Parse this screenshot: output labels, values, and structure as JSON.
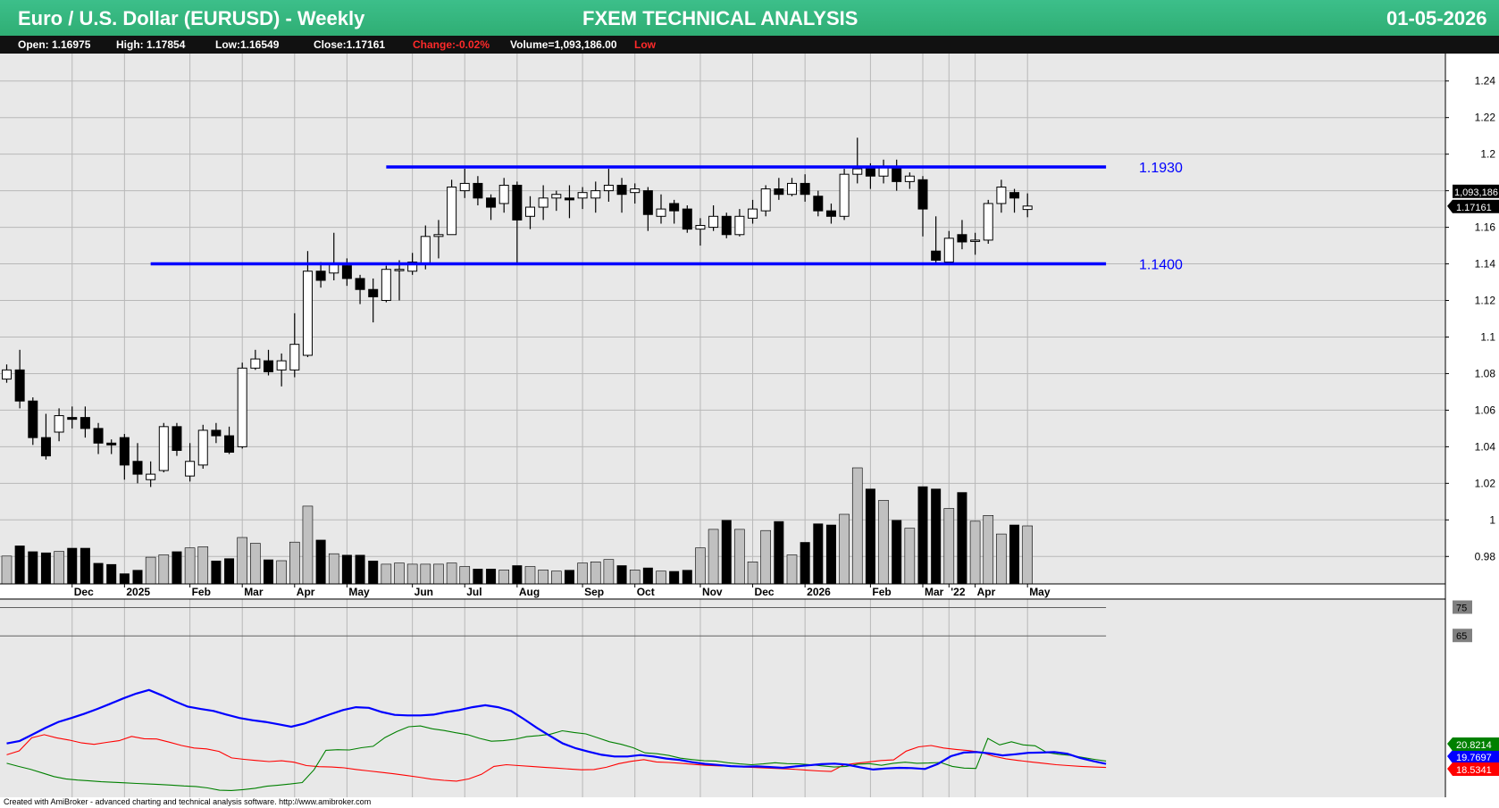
{
  "header": {
    "left_title": "Euro / U.S. Dollar (EURUSD) - Weekly",
    "center_title": "FXEM TECHNICAL ANALYSIS",
    "date": "01-05-2026"
  },
  "info": {
    "open": "Open: 1.16975",
    "high": "High: 1.17854",
    "low": "Low:1.16549",
    "close": "Close:1.17161",
    "change": "Change:-0.02%",
    "volume": "Volume=1,093,186.00",
    "low_flag": "Low"
  },
  "footer": "Created with AmiBroker - advanced charting and technical analysis software. http://www.amibroker.com",
  "colors": {
    "bull_fill": "#ffffff",
    "bear_fill": "#000000",
    "bear_volume": "#000000",
    "bull_volume": "#c0c0c0",
    "channel": "#0000ff",
    "adx": "#0000ff",
    "plus_di": "#008000",
    "minus_di": "#ff0000",
    "plot_bg": "#e8e8e8",
    "grid": "#b8b8b8"
  },
  "chart_data": [
    {
      "type": "candlestick",
      "title": "Euro / U.S. Dollar (EURUSD) - Weekly",
      "ylim": [
        0.965,
        1.255
      ],
      "y_ticks": [
        0.98,
        1,
        1.02,
        1.04,
        1.06,
        1.08,
        1.1,
        1.12,
        1.14,
        1.16,
        1.18,
        1.2,
        1.22,
        1.24
      ],
      "y_tick_labels": [
        "0.98",
        "1",
        "1.02",
        "1.04",
        "1.06",
        "1.08",
        "1.1",
        "1.12",
        "1.14",
        "1.16",
        "1.18",
        "1.2",
        "1.22",
        "1.24"
      ],
      "x_labels": [
        {
          "bar": 5,
          "label": "Dec"
        },
        {
          "bar": 9,
          "label": "2025"
        },
        {
          "bar": 14,
          "label": "Feb"
        },
        {
          "bar": 18,
          "label": "Mar"
        },
        {
          "bar": 22,
          "label": "Apr"
        },
        {
          "bar": 26,
          "label": "May"
        },
        {
          "bar": 31,
          "label": "Jun"
        },
        {
          "bar": 35,
          "label": "Jul"
        },
        {
          "bar": 39,
          "label": "Aug"
        },
        {
          "bar": 44,
          "label": "Sep"
        },
        {
          "bar": 48,
          "label": "Oct"
        },
        {
          "bar": 53,
          "label": "Nov"
        },
        {
          "bar": 57,
          "label": "Dec"
        },
        {
          "bar": 61,
          "label": "2026"
        },
        {
          "bar": 66,
          "label": "Feb"
        },
        {
          "bar": 70,
          "label": "Mar"
        },
        {
          "bar": 72,
          "label": "'22"
        },
        {
          "bar": 74,
          "label": "Apr"
        },
        {
          "bar": 78,
          "label": "May"
        }
      ],
      "candles": [
        [
          1.077,
          1.082,
          1.085,
          1.075
        ],
        [
          1.082,
          1.065,
          1.093,
          1.061
        ],
        [
          1.065,
          1.045,
          1.067,
          1.041
        ],
        [
          1.045,
          1.035,
          1.058,
          1.033
        ],
        [
          1.048,
          1.057,
          1.061,
          1.043
        ],
        [
          1.056,
          1.055,
          1.062,
          1.05
        ],
        [
          1.056,
          1.05,
          1.062,
          1.045
        ],
        [
          1.05,
          1.042,
          1.053,
          1.036
        ],
        [
          1.042,
          1.041,
          1.044,
          1.036
        ],
        [
          1.045,
          1.03,
          1.047,
          1.022
        ],
        [
          1.032,
          1.025,
          1.042,
          1.02
        ],
        [
          1.022,
          1.025,
          1.032,
          1.018
        ],
        [
          1.027,
          1.051,
          1.053,
          1.026
        ],
        [
          1.051,
          1.038,
          1.053,
          1.035
        ],
        [
          1.024,
          1.032,
          1.042,
          1.021
        ],
        [
          1.03,
          1.049,
          1.052,
          1.028
        ],
        [
          1.049,
          1.046,
          1.053,
          1.042
        ],
        [
          1.046,
          1.037,
          1.051,
          1.036
        ],
        [
          1.04,
          1.083,
          1.086,
          1.039
        ],
        [
          1.083,
          1.088,
          1.093,
          1.082
        ],
        [
          1.087,
          1.081,
          1.093,
          1.079
        ],
        [
          1.082,
          1.087,
          1.091,
          1.073
        ],
        [
          1.082,
          1.096,
          1.113,
          1.078
        ],
        [
          1.09,
          1.136,
          1.147,
          1.089
        ],
        [
          1.136,
          1.131,
          1.141,
          1.127
        ],
        [
          1.135,
          1.14,
          1.157,
          1.131
        ],
        [
          1.139,
          1.132,
          1.143,
          1.128
        ],
        [
          1.132,
          1.126,
          1.134,
          1.118
        ],
        [
          1.126,
          1.122,
          1.132,
          1.108
        ],
        [
          1.12,
          1.137,
          1.139,
          1.119
        ],
        [
          1.137,
          1.137,
          1.142,
          1.12
        ],
        [
          1.136,
          1.141,
          1.146,
          1.134
        ],
        [
          1.14,
          1.155,
          1.161,
          1.137
        ],
        [
          1.155,
          1.156,
          1.164,
          1.143
        ],
        [
          1.156,
          1.182,
          1.186,
          1.157
        ],
        [
          1.18,
          1.184,
          1.192,
          1.176
        ],
        [
          1.184,
          1.176,
          1.188,
          1.172
        ],
        [
          1.176,
          1.171,
          1.178,
          1.164
        ],
        [
          1.173,
          1.183,
          1.187,
          1.168
        ],
        [
          1.183,
          1.164,
          1.185,
          1.14
        ],
        [
          1.166,
          1.171,
          1.177,
          1.159
        ],
        [
          1.171,
          1.176,
          1.183,
          1.164
        ],
        [
          1.176,
          1.178,
          1.18,
          1.169
        ],
        [
          1.176,
          1.175,
          1.183,
          1.165
        ],
        [
          1.176,
          1.179,
          1.182,
          1.17
        ],
        [
          1.176,
          1.18,
          1.185,
          1.168
        ],
        [
          1.18,
          1.183,
          1.192,
          1.174
        ],
        [
          1.183,
          1.178,
          1.187,
          1.168
        ],
        [
          1.179,
          1.181,
          1.184,
          1.173
        ],
        [
          1.18,
          1.167,
          1.182,
          1.158
        ],
        [
          1.166,
          1.17,
          1.178,
          1.162
        ],
        [
          1.173,
          1.169,
          1.175,
          1.162
        ],
        [
          1.17,
          1.159,
          1.172,
          1.157
        ],
        [
          1.159,
          1.161,
          1.165,
          1.15
        ],
        [
          1.16,
          1.166,
          1.172,
          1.158
        ],
        [
          1.166,
          1.156,
          1.168,
          1.154
        ],
        [
          1.156,
          1.166,
          1.17,
          1.155
        ],
        [
          1.165,
          1.17,
          1.175,
          1.162
        ],
        [
          1.169,
          1.181,
          1.183,
          1.166
        ],
        [
          1.181,
          1.178,
          1.187,
          1.175
        ],
        [
          1.178,
          1.184,
          1.187,
          1.177
        ],
        [
          1.184,
          1.178,
          1.189,
          1.174
        ],
        [
          1.177,
          1.169,
          1.18,
          1.166
        ],
        [
          1.169,
          1.166,
          1.173,
          1.162
        ],
        [
          1.166,
          1.189,
          1.192,
          1.164
        ],
        [
          1.189,
          1.192,
          1.209,
          1.184
        ],
        [
          1.192,
          1.188,
          1.195,
          1.181
        ],
        [
          1.188,
          1.193,
          1.197,
          1.184
        ],
        [
          1.193,
          1.185,
          1.197,
          1.18
        ],
        [
          1.185,
          1.188,
          1.19,
          1.181
        ],
        [
          1.186,
          1.17,
          1.188,
          1.155
        ],
        [
          1.147,
          1.142,
          1.166,
          1.14
        ],
        [
          1.141,
          1.154,
          1.158,
          1.14
        ],
        [
          1.156,
          1.152,
          1.164,
          1.148
        ],
        [
          1.153,
          1.153,
          1.157,
          1.145
        ],
        [
          1.153,
          1.173,
          1.175,
          1.151
        ],
        [
          1.173,
          1.182,
          1.186,
          1.168
        ],
        [
          1.179,
          1.176,
          1.181,
          1.168
        ],
        [
          1.16975,
          1.17161,
          1.17854,
          1.16549
        ]
      ],
      "volume": [
        24,
        33,
        28,
        27,
        28,
        31,
        31,
        18,
        17,
        9,
        12,
        23,
        25,
        28,
        31,
        32,
        20,
        22,
        40,
        35,
        21,
        20,
        36,
        67,
        38,
        26,
        25,
        25,
        20,
        17,
        18,
        17,
        17,
        17,
        18,
        15,
        13,
        13,
        12,
        16,
        15,
        12,
        11,
        12,
        18,
        19,
        21,
        16,
        12,
        14,
        11,
        11,
        12,
        31,
        47,
        55,
        47,
        19,
        46,
        54,
        25,
        36,
        52,
        51,
        60,
        100,
        82,
        72,
        55,
        48,
        84,
        82,
        65,
        79,
        54,
        59,
        43,
        51,
        50
      ],
      "price_labels": [
        "1,093,186",
        "1.17161"
      ],
      "channel": [
        {
          "level": 1.193,
          "label": "1.1930",
          "from_bar": 29,
          "to_bar": 84
        },
        {
          "level": 1.14,
          "label": "1.1400",
          "from_bar": 11,
          "to_bar": 84
        }
      ]
    },
    {
      "type": "line",
      "ylim": [
        8,
        78
      ],
      "reference_lines": [
        {
          "value": 75,
          "label": "75"
        },
        {
          "value": 65,
          "label": "65"
        }
      ],
      "series": [
        {
          "key": "adx",
          "last_label": "19.7697",
          "values": [
            27,
            27.9,
            30.2,
            32.5,
            34.6,
            36.0,
            37.5,
            39.2,
            41.0,
            42.9,
            44.6,
            45.9,
            44.0,
            41.9,
            40.0,
            39.2,
            38.5,
            37.2,
            36.0,
            35.2,
            34.6,
            33.8,
            32.9,
            34.0,
            35.7,
            37.3,
            38.8,
            39.8,
            39.6,
            38.1,
            37.1,
            36.9,
            36.9,
            37.2,
            38.1,
            38.8,
            39.8,
            40.5,
            39.8,
            38.5,
            35.6,
            32.5,
            29.7,
            27.0,
            25.3,
            24.1,
            23.0,
            22.4,
            22.4,
            22.9,
            22.4,
            21.7,
            21.2,
            20.4,
            19.8,
            19.4,
            19.0,
            18.8,
            18.9,
            18.7,
            18.4,
            18.9,
            19.3,
            19.7,
            19.9,
            19.5,
            18.6,
            17.8,
            18.2,
            18.4,
            18.3,
            18.0,
            19.8,
            22.5,
            23.8,
            24.0,
            23.5,
            22.8,
            23.2,
            23.7,
            23.8,
            24.0,
            23.4,
            21.9,
            20.8,
            19.8
          ]
        },
        {
          "key": "plus_di",
          "last_label": "20.8214",
          "values": [
            20,
            18.9,
            17.9,
            16.6,
            15.3,
            14.5,
            14.1,
            13.8,
            13.5,
            13.3,
            13.1,
            12.9,
            12.7,
            12.5,
            12.3,
            12.0,
            11.8,
            11.3,
            10.5,
            10.4,
            10.7,
            11.2,
            11.9,
            12.3,
            12.7,
            13.2,
            17.7,
            24.6,
            24.8,
            24.7,
            25.5,
            26.0,
            29.1,
            31.2,
            32.9,
            33.2,
            32.2,
            31.6,
            30.8,
            30.1,
            28.8,
            27.8,
            28.0,
            28.5,
            29.4,
            29.8,
            30.3,
            31.5,
            30.9,
            30.4,
            29.0,
            27.6,
            26.7,
            25.5,
            23.7,
            23.4,
            22.8,
            21.8,
            21.3,
            20.9,
            20.8,
            20.2,
            19.8,
            19.5,
            19.8,
            20.2,
            19.9,
            19.8,
            19.5,
            19.1,
            18.7,
            18.9,
            19.7,
            19.9,
            19.3,
            20.0,
            20.4,
            20.0,
            20.1,
            20.3,
            18.9,
            18.3,
            18.2,
            28.8,
            26.5,
            27.6,
            26.5,
            26.2,
            23.8,
            23.2,
            22.8,
            22.1,
            21.4,
            20.8
          ]
        },
        {
          "key": "minus_di",
          "last_label": "18.5341",
          "values": [
            23,
            24.4,
            29.0,
            30.1,
            29.0,
            28.2,
            27.2,
            26.7,
            27.4,
            28.0,
            29.5,
            28.7,
            28.6,
            27.5,
            26.3,
            25.4,
            25.1,
            24.2,
            21.9,
            21.4,
            21.0,
            20.6,
            20.9,
            20.4,
            19.2,
            18.8,
            18.7,
            18.4,
            17.8,
            17.3,
            16.8,
            16.3,
            15.7,
            15.1,
            14.4,
            14.0,
            13.7,
            14.5,
            16.1,
            18.9,
            19.5,
            19.2,
            18.9,
            18.6,
            18.3,
            18.0,
            17.7,
            17.8,
            18.6,
            19.9,
            20.7,
            21.3,
            20.5,
            20.3,
            20.0,
            19.6,
            19.3,
            19.1,
            19.0,
            18.7,
            18.5,
            18.3,
            18.1,
            17.9,
            17.6,
            17.3,
            17.1,
            19.4,
            20.0,
            20.5,
            21.0,
            21.2,
            24.3,
            25.8,
            26.3,
            25.4,
            24.9,
            24.5,
            23.9,
            22.5,
            21.6,
            21.0,
            20.5,
            20.0,
            19.5,
            19.2,
            18.9,
            18.7,
            18.5341
          ]
        }
      ]
    }
  ]
}
